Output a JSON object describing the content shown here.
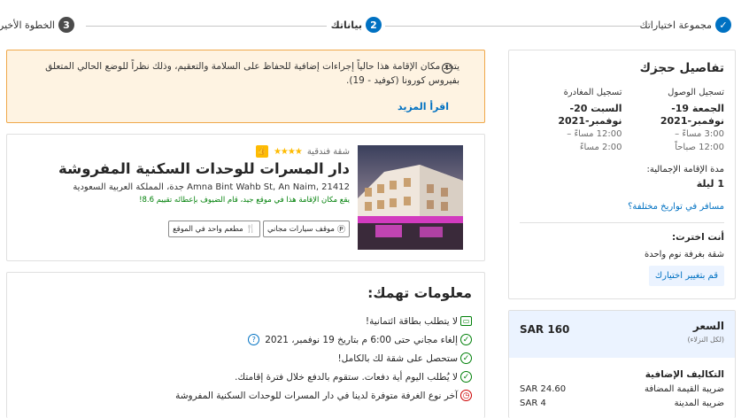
{
  "progress": {
    "steps": [
      {
        "number": "",
        "label": "مجموعة اختياراتك"
      },
      {
        "number": "2",
        "label": "بياناتك"
      },
      {
        "number": "3",
        "label": "الخطوة الأخيرة"
      }
    ],
    "colors": {
      "active": "#0071c2",
      "pending": "#4b4b4b"
    }
  },
  "notice": {
    "text": "يتخذ مكان الإقامة هذا حالياً إجراءات إضافية للحفاظ على السلامة والتعقيم، وذلك نظراً للوضع الحالي المتعلق بفيروس كورونا (كوفيد - 19).",
    "link": "اقرأ المزيد"
  },
  "hotel": {
    "type": "شقة فندقية",
    "stars": "★★★★",
    "name": "دار المسرات للوحدات السكنية المفروشة",
    "address": "Amna Bint Wahb St, An Naim, 21412 جدة، المملكة العربية السعودية",
    "location_note": "يقع مكان الإقامة هذا في موقع جيد، قام الضيوف بإعطائه تقييم 8.6!",
    "amenities": [
      {
        "icon": "parking-icon",
        "label": "موقف سيارات مجاني"
      },
      {
        "icon": "restaurant-icon",
        "label": "مطعم واحد في الموقع"
      }
    ]
  },
  "needs": {
    "title": "معلومات تهمك:",
    "items": [
      {
        "icon": "card-icon",
        "text": "لا يتطلب بطاقة ائتمانية!"
      },
      {
        "icon": "check-icon",
        "text": "إلغاء مجاني حتى 6:00 م بتاريخ 19 نوفمبر، 2021"
      },
      {
        "icon": "check-icon",
        "text": "ستحصل على شقة لك بالكامل!"
      },
      {
        "icon": "check-icon",
        "text": "لا يُطلب اليوم أية دفعات. ستقوم بالدفع خلال فترة إقامتك."
      },
      {
        "icon": "clock-icon",
        "text": "آخر نوع الغرفة متوفرة لدينا في دار المسرات للوحدات السكنية المفروشة"
      }
    ]
  },
  "booking": {
    "title": "تفاصيل حجزك",
    "checkin": {
      "label": "تسجيل الوصول",
      "date": "الجمعة 19- نوفمبر-2021",
      "time1": "3:00 مساءً –",
      "time2": "12:00 صباحاً"
    },
    "checkout": {
      "label": "تسجيل المغادرة",
      "date": "السبت 20- نوفمبر-2021",
      "time1": "12:00 مساءً –",
      "time2": "2:00 مساءً"
    },
    "stay_label": "مدة الإقامة الإجمالية:",
    "stay_value": "1 ليلة",
    "change_dates": "مسافر في تواريخ مختلفة؟",
    "selected_label": "أنت اخترت:",
    "selected_value": "شقة بغرفة نوم واحدة",
    "change_selection": "قم بتغيير اختيارك"
  },
  "price": {
    "label": "السعر",
    "note": "(لكل النزلاء)",
    "total": "SAR 160",
    "extra_title": "التكاليف الإضافية",
    "fees": [
      {
        "label": "ضريبة القيمة المضافة",
        "value": "SAR 24.60"
      },
      {
        "label": "ضريبة المدينة",
        "value": "SAR 4"
      }
    ]
  }
}
